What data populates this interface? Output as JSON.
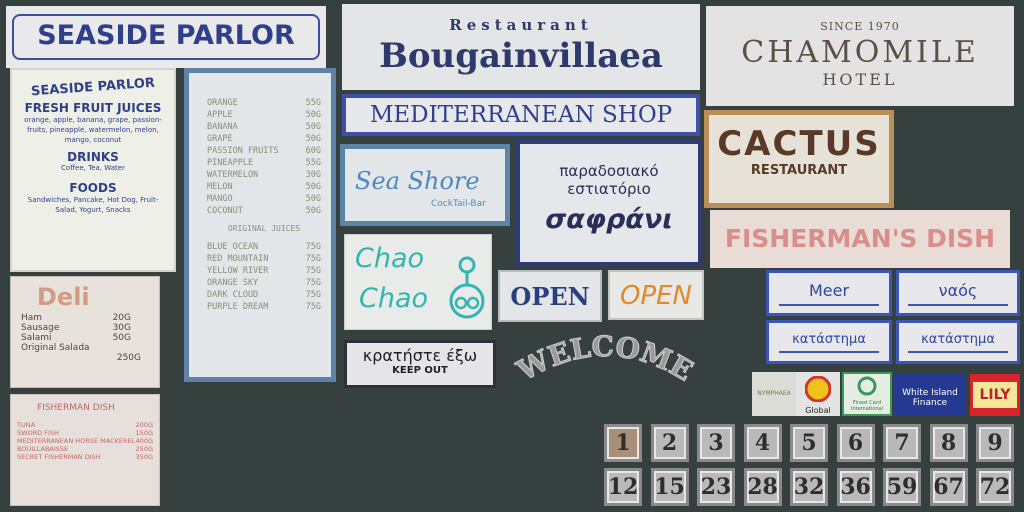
{
  "seaside_header": "SEASIDE PARLOR",
  "seaside_menu": {
    "title": "SEASIDE PARLOR",
    "sections": [
      {
        "heading": "FRESH FRUIT JUICES",
        "body": "orange, apple, banana, grape, passion-fruits, pineapple, watermelon, melon, mango, coconut"
      },
      {
        "heading": "DRINKS",
        "body": "Coffee, Tea, Water"
      },
      {
        "heading": "FOODS",
        "body": "Sandwiches, Pancake, Hot Dog, Fruit-Salad, Yogurt, Snacks"
      }
    ]
  },
  "juice_menu": {
    "items": [
      {
        "name": "ORANGE",
        "price": "55G"
      },
      {
        "name": "APPLE",
        "price": "50G"
      },
      {
        "name": "BANANA",
        "price": "50G"
      },
      {
        "name": "GRAPE",
        "price": "50G"
      },
      {
        "name": "PASSION FRUITS",
        "price": "60G"
      },
      {
        "name": "PINEAPPLE",
        "price": "55G"
      },
      {
        "name": "WATERMELON",
        "price": "30G"
      },
      {
        "name": "MELON",
        "price": "50G"
      },
      {
        "name": "MANGO",
        "price": "50G"
      },
      {
        "name": "COCONUT",
        "price": "50G"
      }
    ],
    "subheading": "ORIGINAL JUICES",
    "originals": [
      {
        "name": "BLUE OCEAN",
        "price": "75G"
      },
      {
        "name": "RED MOUNTAIN",
        "price": "75G"
      },
      {
        "name": "YELLOW RIVER",
        "price": "75G"
      },
      {
        "name": "ORANGE SKY",
        "price": "75G"
      },
      {
        "name": "DARK CLOUD",
        "price": "75G"
      },
      {
        "name": "PURPLE DREAM",
        "price": "75G"
      }
    ]
  },
  "restaurant_sign": {
    "small": "Restaurant",
    "big": "Bougainvillaea"
  },
  "hotel_sign": {
    "since": "SINCE 1970",
    "name": "CHAMOMILE",
    "type": "HOTEL"
  },
  "med_shop": "MEDITERRANEAN SHOP",
  "cactus": {
    "name": "CACTUS",
    "sub": "RESTAURANT"
  },
  "fisherman_sign": "FISHERMAN'S DISH",
  "seashore": {
    "name": "Sea Shore",
    "sub": "CockTail-Bar"
  },
  "greek_restaurant": {
    "line1": "παραδοσιακό",
    "line2": "εστιατόριο",
    "big": "σαφράνι"
  },
  "chao": {
    "line1": "Chao",
    "line2": "Chao"
  },
  "open_blue": "OPEN",
  "open_orange": "OPEN",
  "keep_out": {
    "greek": "κρατήστε έξω",
    "english": "KEEP OUT"
  },
  "welcome": "WELCOME",
  "direction_signs": [
    "Meer",
    "ναός",
    "κατάστημα",
    "κατάστημα"
  ],
  "deli": {
    "title": "Deli",
    "items": [
      {
        "name": "Ham",
        "price": "20G"
      },
      {
        "name": "Sausage",
        "price": "30G"
      },
      {
        "name": "Salami",
        "price": "50G"
      },
      {
        "name": "Original Salada",
        "price": "250G"
      }
    ]
  },
  "fisherman_menu": {
    "title": "FISHERMAN DISH",
    "items": [
      {
        "name": "TUNA",
        "price": "200G"
      },
      {
        "name": "SWORD FISH",
        "price": "150G"
      },
      {
        "name": "MEDITERRANEAN HORSE MACKEREL",
        "price": "400G"
      },
      {
        "name": "BOUILLABAISSE",
        "price": "250G"
      },
      {
        "name": "SECRET FISHERMAN DISH",
        "price": "350G"
      }
    ]
  },
  "logos": {
    "nymphaea": "NYMPHAEA",
    "global": "Global",
    "finest": "Finest Card International",
    "white_island": "White Island Finance",
    "lily": "LILY"
  },
  "numbers_row1": [
    "1",
    "2",
    "3",
    "4",
    "5",
    "6",
    "7",
    "8",
    "9"
  ],
  "numbers_row2": [
    "12",
    "15",
    "23",
    "28",
    "32",
    "36",
    "59",
    "67",
    "72"
  ],
  "colors": {
    "navy": "#2e3f8c",
    "background": "#36403f",
    "orange": "#e08a2a",
    "brown": "#5a3a26"
  }
}
